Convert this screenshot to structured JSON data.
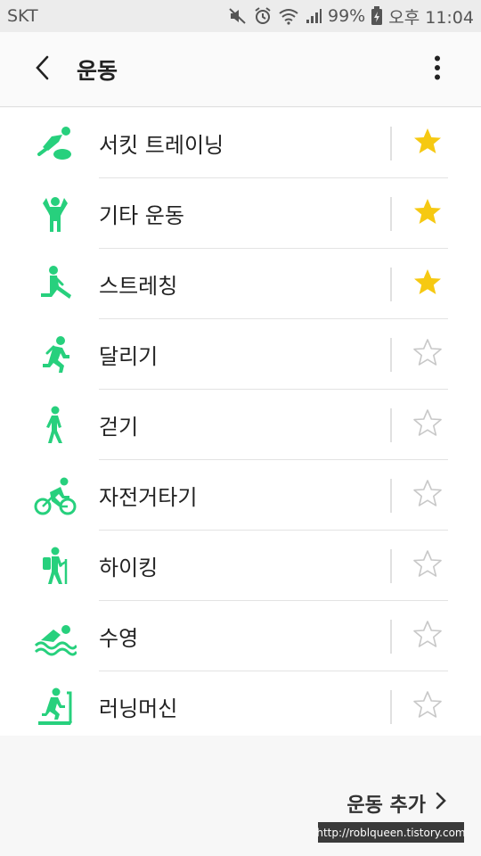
{
  "status_bar": {
    "carrier": "SKT",
    "battery": "99%",
    "time": "오후 11:04",
    "icons": [
      "mute-icon",
      "alarm-icon",
      "wifi-icon",
      "signal-icon",
      "battery-icon"
    ]
  },
  "header": {
    "title": "운동",
    "back_icon": "chevron-left-icon",
    "menu_icon": "more-vertical-icon"
  },
  "exercises": [
    {
      "label": "서킷 트레이닝",
      "icon": "circuit-training-icon",
      "favorite": true
    },
    {
      "label": "기타 운동",
      "icon": "other-workout-icon",
      "favorite": true
    },
    {
      "label": "스트레칭",
      "icon": "stretching-icon",
      "favorite": true
    },
    {
      "label": "달리기",
      "icon": "running-icon",
      "favorite": false
    },
    {
      "label": "걷기",
      "icon": "walking-icon",
      "favorite": false
    },
    {
      "label": "자전거타기",
      "icon": "cycling-icon",
      "favorite": false
    },
    {
      "label": "하이킹",
      "icon": "hiking-icon",
      "favorite": false
    },
    {
      "label": "수영",
      "icon": "swimming-icon",
      "favorite": false
    },
    {
      "label": "러닝머신",
      "icon": "treadmill-icon",
      "favorite": false
    }
  ],
  "footer": {
    "add_label": "운동 추가",
    "watermark": "http://roblqueen.tistory.com"
  },
  "colors": {
    "accent_green": "#27d07d",
    "star_on": "#f6c912",
    "star_off": "#c8c8c8"
  }
}
